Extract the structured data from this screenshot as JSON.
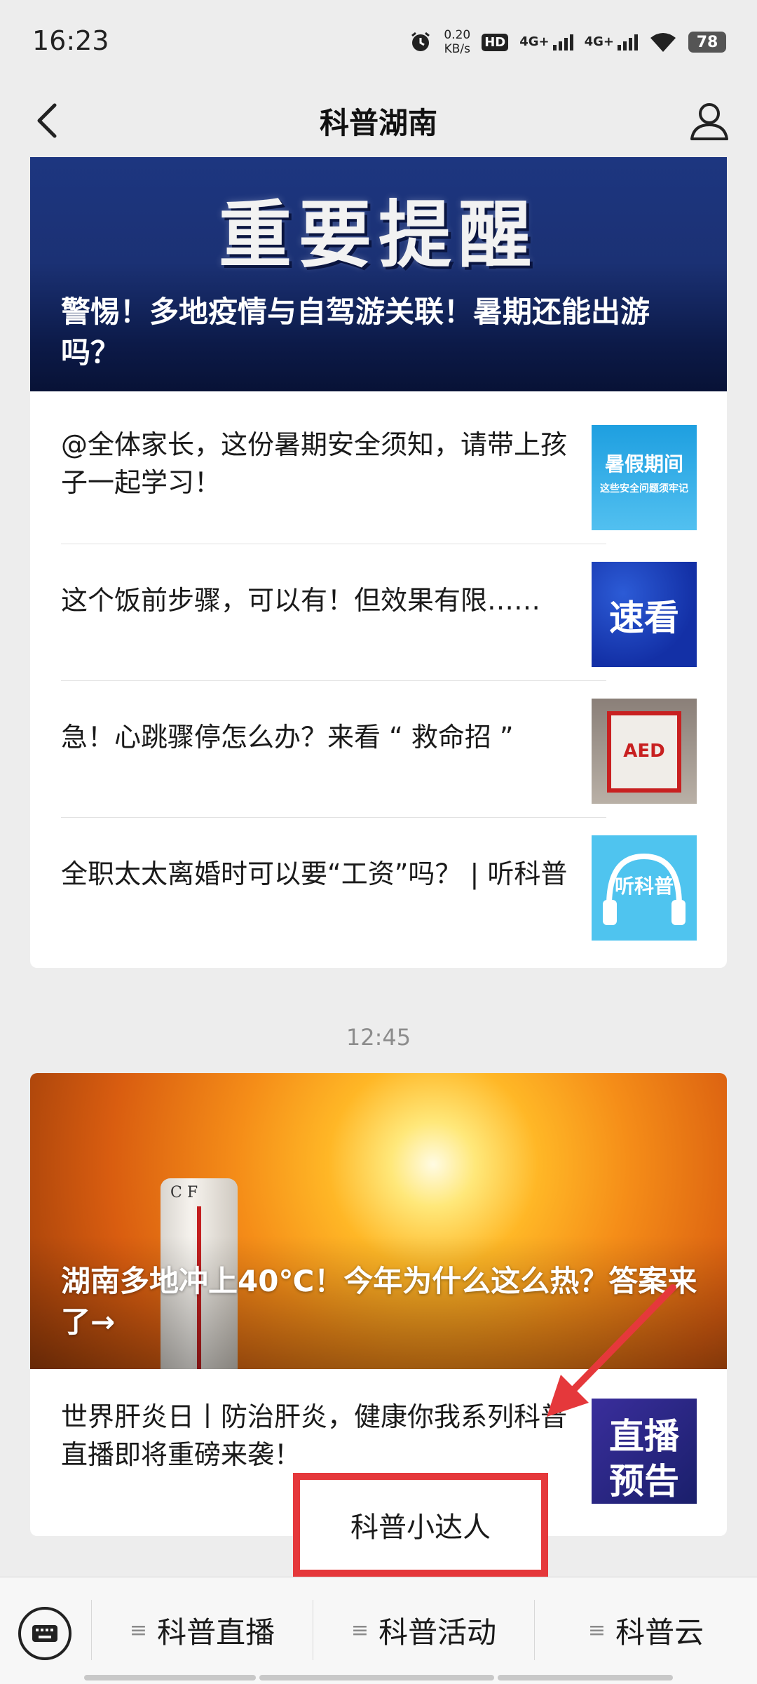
{
  "status_bar": {
    "time": "16:23",
    "net_speed_value": "0.20",
    "net_speed_unit": "KB/s",
    "hd": "HD",
    "sim1": "4G+",
    "sim2": "4G+",
    "battery": "78"
  },
  "nav": {
    "title": "科普湖南",
    "back_icon": "chevron-left-icon",
    "profile_icon": "person-icon"
  },
  "feed": {
    "group1": {
      "hero": {
        "banner_text": "重要提醒",
        "title": "警惕！多地疫情与自驾游关联！暑期还能出游吗？"
      },
      "items": [
        {
          "title": "@全体家长，这份暑期安全须知，请带上孩子一起学习！",
          "thumb_text": "暑假期间",
          "thumb_sub": "这些安全问题须牢记"
        },
        {
          "title": "这个饭前步骤，可以有！但效果有限……",
          "thumb_text": "速看"
        },
        {
          "title": "急！心跳骤停怎么办？来看 “ 救命招 ”",
          "thumb_text": "AED"
        },
        {
          "title": "全职太太离婚时可以要“工资”吗？ | 听科普",
          "thumb_text": "听科普"
        }
      ]
    },
    "time_divider": "12:45",
    "group2": {
      "hero": {
        "title": "湖南多地冲上40℃！今年为什么这么热？答案来了→",
        "thermo_label": "C F"
      },
      "items": [
        {
          "title": "世界肝炎日丨防治肝炎，健康你我系列科普直播即将重磅来袭！",
          "thumb_text_1": "直播",
          "thumb_text_2": "预告"
        }
      ]
    }
  },
  "annotation": {
    "label": "科普小达人",
    "color": "#e5383b"
  },
  "bottom_menu": {
    "keyboard_icon": "keyboard-icon",
    "items": [
      {
        "label": "科普直播"
      },
      {
        "label": "科普活动"
      },
      {
        "label": "科普云"
      }
    ]
  }
}
